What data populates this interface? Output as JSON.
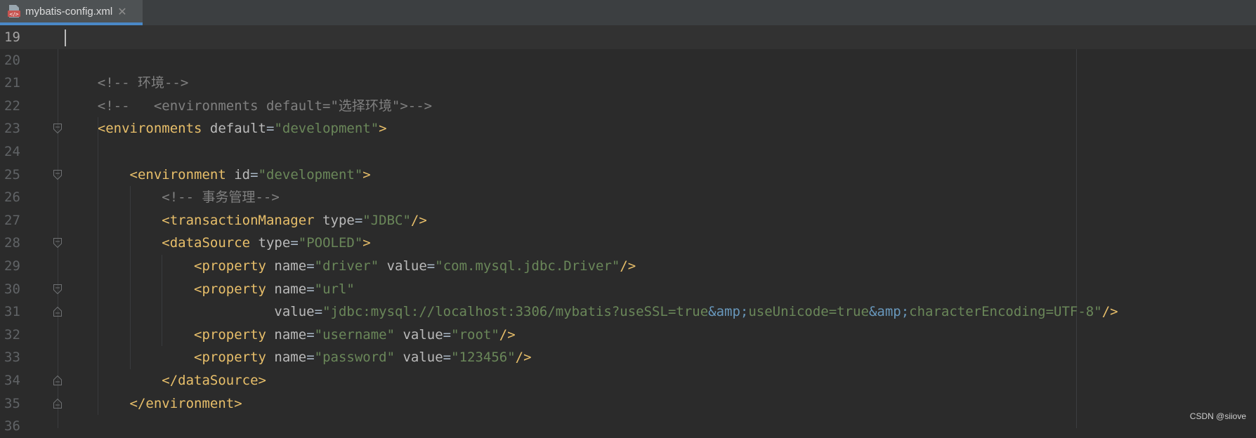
{
  "tab": {
    "title": "mybatis-config.xml",
    "close": "✕",
    "icon": "xml-file-icon"
  },
  "watermark": "CSDN @siiove",
  "lines": [
    {
      "num": "19",
      "current": true,
      "fold": "none",
      "tokens": []
    },
    {
      "num": "20",
      "fold": "none",
      "tokens": []
    },
    {
      "num": "21",
      "fold": "none",
      "tokens": [
        {
          "t": "    <!-- 环境-->",
          "c": "t-c"
        }
      ]
    },
    {
      "num": "22",
      "fold": "none",
      "tokens": [
        {
          "t": "    <!--   <environments default=\"选择环境\">-->",
          "c": "t-c"
        }
      ]
    },
    {
      "num": "23",
      "fold": "open",
      "tokens": [
        {
          "t": "    <",
          "c": "t-br"
        },
        {
          "t": "environments",
          "c": "t-tag"
        },
        {
          "t": " default",
          "c": "t-at"
        },
        {
          "t": "=",
          "c": "t-eq"
        },
        {
          "t": "\"development\"",
          "c": "t-val"
        },
        {
          "t": ">",
          "c": "t-br"
        }
      ]
    },
    {
      "num": "24",
      "fold": "none",
      "tokens": []
    },
    {
      "num": "25",
      "fold": "open",
      "tokens": [
        {
          "t": "        <",
          "c": "t-br"
        },
        {
          "t": "environment",
          "c": "t-tag"
        },
        {
          "t": " id",
          "c": "t-at"
        },
        {
          "t": "=",
          "c": "t-eq"
        },
        {
          "t": "\"development\"",
          "c": "t-val"
        },
        {
          "t": ">",
          "c": "t-br"
        }
      ]
    },
    {
      "num": "26",
      "fold": "none",
      "tokens": [
        {
          "t": "            <!-- 事务管理-->",
          "c": "t-c"
        }
      ]
    },
    {
      "num": "27",
      "fold": "none",
      "tokens": [
        {
          "t": "            <",
          "c": "t-br"
        },
        {
          "t": "transactionManager",
          "c": "t-tag"
        },
        {
          "t": " type",
          "c": "t-at"
        },
        {
          "t": "=",
          "c": "t-eq"
        },
        {
          "t": "\"JDBC\"",
          "c": "t-val"
        },
        {
          "t": "/>",
          "c": "t-br"
        }
      ]
    },
    {
      "num": "28",
      "fold": "open",
      "tokens": [
        {
          "t": "            <",
          "c": "t-br"
        },
        {
          "t": "dataSource",
          "c": "t-tag"
        },
        {
          "t": " type",
          "c": "t-at"
        },
        {
          "t": "=",
          "c": "t-eq"
        },
        {
          "t": "\"POOLED\"",
          "c": "t-val"
        },
        {
          "t": ">",
          "c": "t-br"
        }
      ]
    },
    {
      "num": "29",
      "fold": "none",
      "tokens": [
        {
          "t": "                <",
          "c": "t-br"
        },
        {
          "t": "property",
          "c": "t-tag"
        },
        {
          "t": " name",
          "c": "t-at"
        },
        {
          "t": "=",
          "c": "t-eq"
        },
        {
          "t": "\"driver\"",
          "c": "t-val"
        },
        {
          "t": " value",
          "c": "t-at"
        },
        {
          "t": "=",
          "c": "t-eq"
        },
        {
          "t": "\"com.mysql.jdbc.Driver\"",
          "c": "t-val"
        },
        {
          "t": "/>",
          "c": "t-br"
        }
      ]
    },
    {
      "num": "30",
      "fold": "open",
      "tokens": [
        {
          "t": "                <",
          "c": "t-br"
        },
        {
          "t": "property",
          "c": "t-tag"
        },
        {
          "t": " name",
          "c": "t-at"
        },
        {
          "t": "=",
          "c": "t-eq"
        },
        {
          "t": "\"url\"",
          "c": "t-val"
        }
      ]
    },
    {
      "num": "31",
      "fold": "close",
      "tokens": [
        {
          "t": "                          value",
          "c": "t-at"
        },
        {
          "t": "=",
          "c": "t-eq"
        },
        {
          "t": "\"jdbc:mysql://localhost:3306/mybatis?useSSL=true",
          "c": "t-val"
        },
        {
          "t": "&amp;",
          "c": "t-ent"
        },
        {
          "t": "useUnicode=true",
          "c": "t-val"
        },
        {
          "t": "&amp;",
          "c": "t-ent"
        },
        {
          "t": "characterEncoding=UTF-8\"",
          "c": "t-val"
        },
        {
          "t": "/>",
          "c": "t-br"
        }
      ]
    },
    {
      "num": "32",
      "fold": "none",
      "tokens": [
        {
          "t": "                <",
          "c": "t-br"
        },
        {
          "t": "property",
          "c": "t-tag"
        },
        {
          "t": " name",
          "c": "t-at"
        },
        {
          "t": "=",
          "c": "t-eq"
        },
        {
          "t": "\"username\"",
          "c": "t-val"
        },
        {
          "t": " value",
          "c": "t-at"
        },
        {
          "t": "=",
          "c": "t-eq"
        },
        {
          "t": "\"root\"",
          "c": "t-val"
        },
        {
          "t": "/>",
          "c": "t-br"
        }
      ]
    },
    {
      "num": "33",
      "fold": "none",
      "tokens": [
        {
          "t": "                <",
          "c": "t-br"
        },
        {
          "t": "property",
          "c": "t-tag"
        },
        {
          "t": " name",
          "c": "t-at"
        },
        {
          "t": "=",
          "c": "t-eq"
        },
        {
          "t": "\"password\"",
          "c": "t-val"
        },
        {
          "t": " value",
          "c": "t-at"
        },
        {
          "t": "=",
          "c": "t-eq"
        },
        {
          "t": "\"123456\"",
          "c": "t-val"
        },
        {
          "t": "/>",
          "c": "t-br"
        }
      ]
    },
    {
      "num": "34",
      "fold": "close",
      "tokens": [
        {
          "t": "            </",
          "c": "t-br"
        },
        {
          "t": "dataSource",
          "c": "t-tag"
        },
        {
          "t": ">",
          "c": "t-br"
        }
      ]
    },
    {
      "num": "35",
      "fold": "close",
      "tokens": [
        {
          "t": "        </",
          "c": "t-br"
        },
        {
          "t": "environment",
          "c": "t-tag"
        },
        {
          "t": ">",
          "c": "t-br"
        }
      ]
    },
    {
      "num": "36",
      "fold": "none",
      "tokens": []
    }
  ]
}
